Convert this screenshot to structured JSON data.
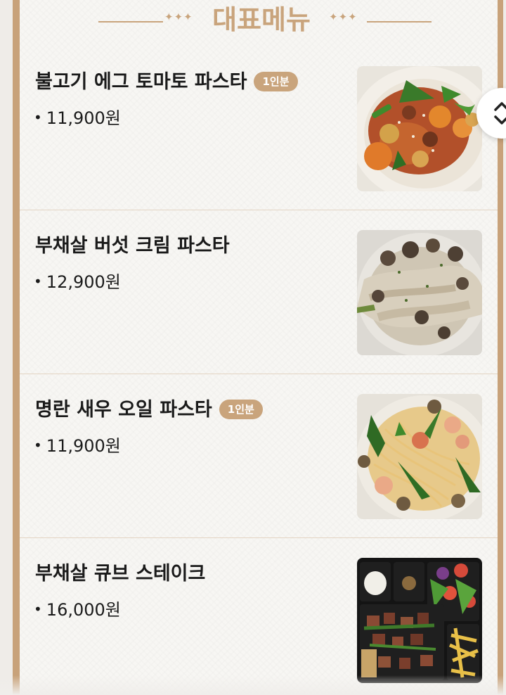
{
  "section": {
    "title": "대표메뉴",
    "ornament_left": "✦✦✦",
    "ornament_right": "✦✦✦"
  },
  "menu": [
    {
      "name": "불고기 에그 토마토 파스타",
      "badge": "1인분",
      "price": "11,900원",
      "photo": "bulgogi-egg-tomato-pasta"
    },
    {
      "name": "부채살 버섯 크림 파스타",
      "badge": "",
      "price": "12,900원",
      "photo": "mushroom-cream-pasta"
    },
    {
      "name": "명란 새우 오일 파스타",
      "badge": "1인분",
      "price": "11,900원",
      "photo": "shrimp-oil-pasta"
    },
    {
      "name": "부채살 큐브 스테이크",
      "badge": "",
      "price": "16,000원",
      "photo": "cube-steak-box"
    }
  ],
  "colors": {
    "accent": "#c9a47c",
    "text": "#1a1a1a",
    "background": "#f7f6f3",
    "frame": "#c8a27a"
  },
  "scroll_button": {
    "icon": "chevron-up-down-icon"
  }
}
